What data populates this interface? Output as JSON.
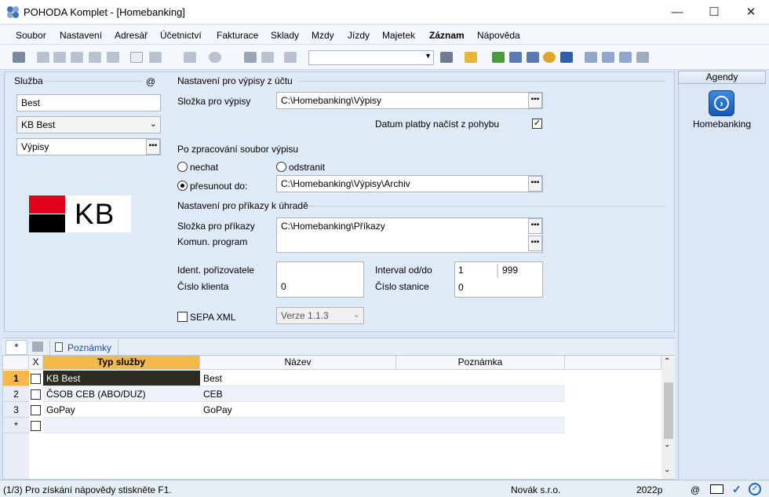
{
  "window": {
    "title": "POHODA Komplet - [Homebanking]",
    "minimize": "—",
    "maximize": "☐",
    "close": "✕"
  },
  "menu": [
    {
      "label": "Soubor"
    },
    {
      "label": "Nastavení"
    },
    {
      "label": "Adresář"
    },
    {
      "label": "Účetnictví"
    },
    {
      "label": "Fakturace"
    },
    {
      "label": "Sklady"
    },
    {
      "label": "Mzdy"
    },
    {
      "label": "Jízdy"
    },
    {
      "label": "Majetek"
    },
    {
      "label": "Záznam"
    },
    {
      "label": "Nápověda"
    }
  ],
  "toolbar": {
    "combo_value": ""
  },
  "sluzba": {
    "group_label": "Služba",
    "at_label": "@",
    "name_value": "Best",
    "bank_value": "KB Best",
    "type_value": "Výpisy",
    "logo_text": "KB"
  },
  "vypisy": {
    "group_label": "Nastavení pro výpisy z účtu",
    "folder_label": "Složka pro výpisy",
    "folder_value": "C:\\Homebanking\\Výpisy",
    "date_label": "Datum platby načíst z pohybu",
    "date_checked": true,
    "after_label": "Po zpracování soubor výpisu",
    "opt_nechat": "nechat",
    "opt_odstranit": "odstranit",
    "opt_presunout": "přesunout do:",
    "archive_value": "C:\\Homebanking\\Výpisy\\Archiv"
  },
  "prikazy": {
    "group_label": "Nastavení pro příkazy k úhradě",
    "folder_label": "Složka pro příkazy",
    "folder_value": "C:\\Homebanking\\Příkazy",
    "program_label": "Komun. program",
    "ident_label": "Ident. pořizovatele",
    "client_label": "Číslo klienta",
    "client_value": "0",
    "interval_label": "Interval od/do",
    "interval_from": "1",
    "interval_to": "999",
    "station_label": "Číslo stanice",
    "station_value": "0",
    "sepa_label": "SEPA XML",
    "version_value": "Verze 1.1.3"
  },
  "agenda": {
    "header": "Agendy",
    "item_label": "Homebanking"
  },
  "tabs": {
    "star": "*",
    "notes": "Poznámky"
  },
  "grid": {
    "headers": {
      "x": "X",
      "typ": "Typ služby",
      "nazev": "Název",
      "poznamka": "Poznámka"
    },
    "rows": [
      {
        "num": "1",
        "typ": "KB Best",
        "nazev": "Best",
        "poznamka": ""
      },
      {
        "num": "2",
        "typ": "ČSOB CEB (ABO/DUZ)",
        "nazev": "CEB",
        "poznamka": ""
      },
      {
        "num": "3",
        "typ": "GoPay",
        "nazev": "GoPay",
        "poznamka": ""
      },
      {
        "num": "*",
        "typ": "",
        "nazev": "",
        "poznamka": ""
      }
    ]
  },
  "status": {
    "help": "(1/3) Pro získání nápovědy stiskněte F1.",
    "company": "Novák s.r.o.",
    "year": "2022p",
    "at": "@"
  },
  "colors": {
    "selected_cell": "#2b2b22",
    "header_highlight": "#f5b84a",
    "kb_red": "#e3001b"
  }
}
